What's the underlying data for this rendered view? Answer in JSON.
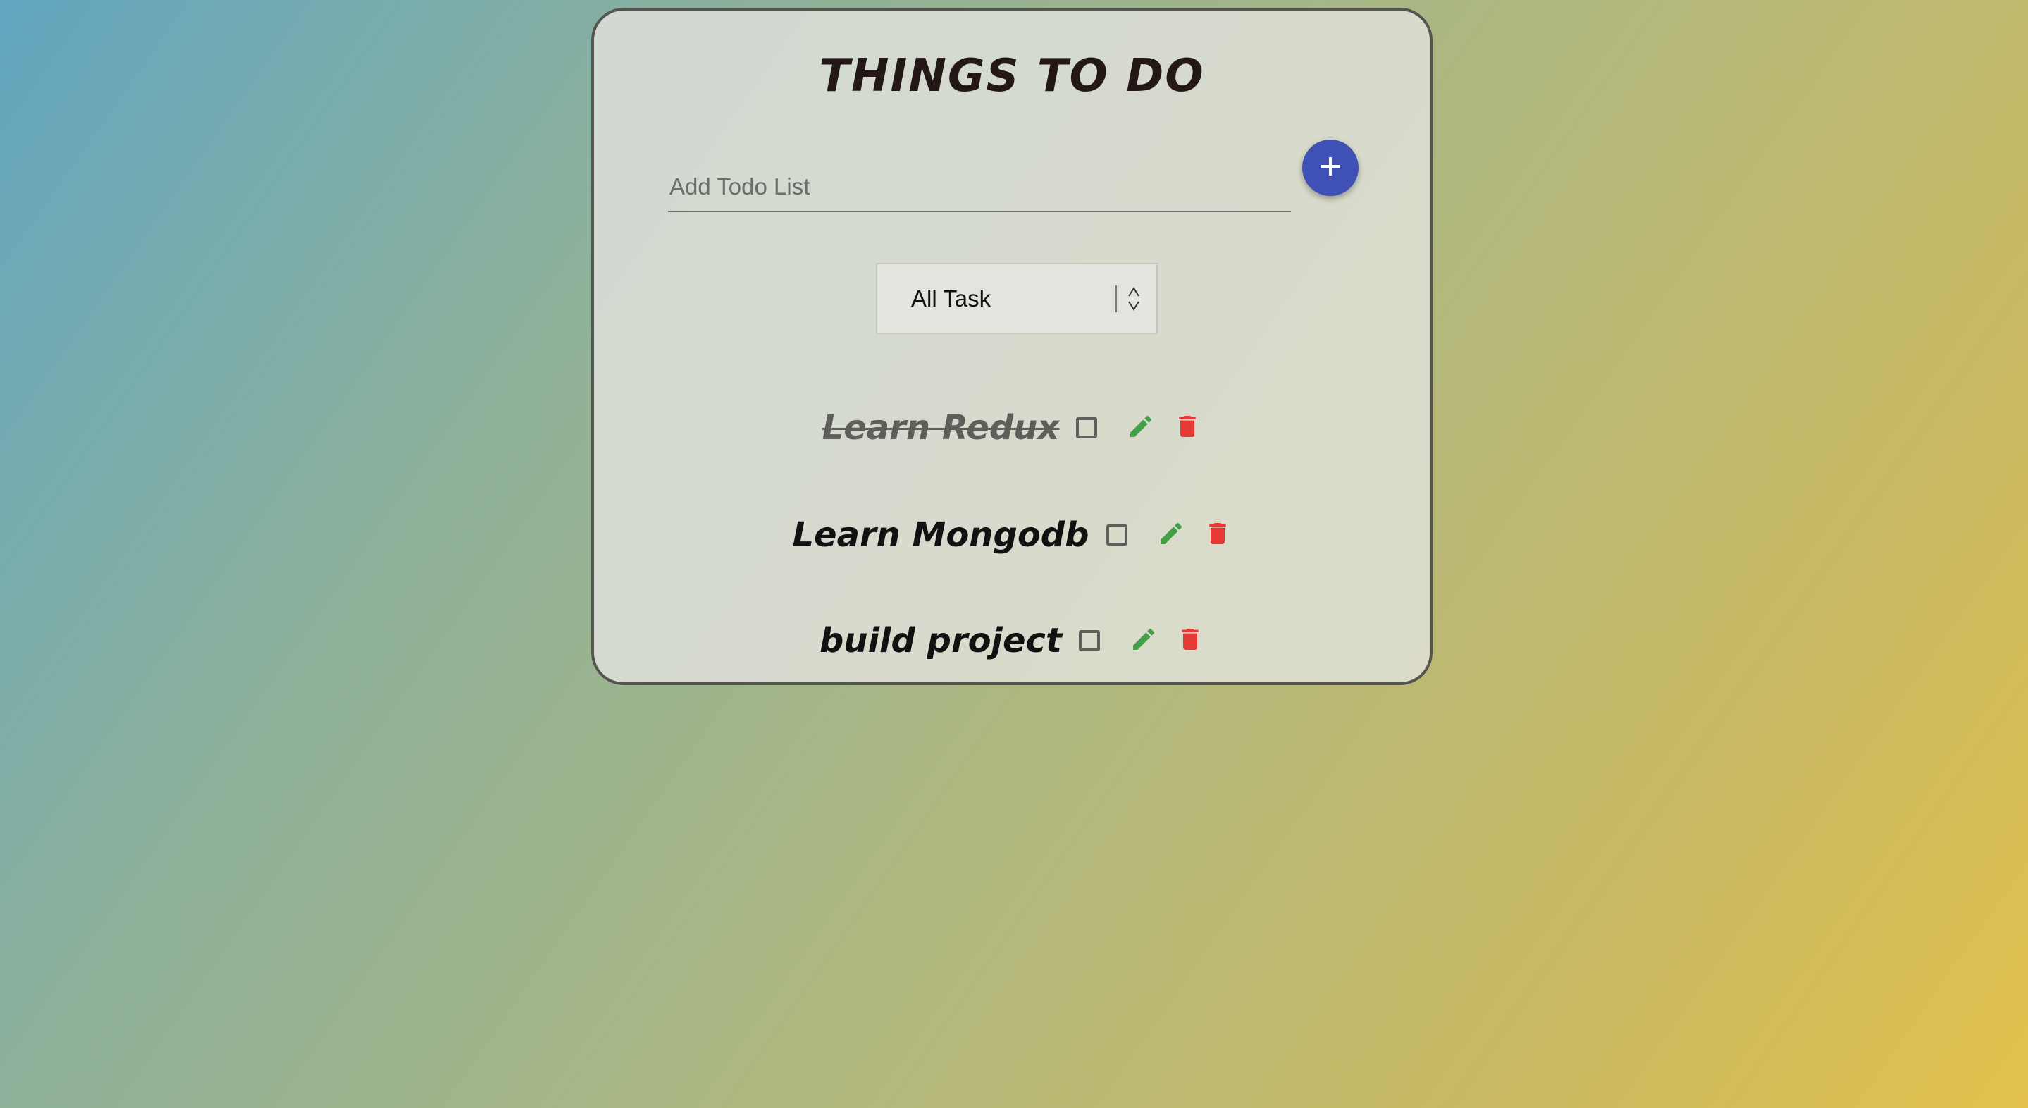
{
  "app": {
    "title": "THINGS TO DO"
  },
  "input": {
    "placeholder": "Add Todo List",
    "value": ""
  },
  "add_button": {
    "icon": "plus-icon",
    "color": "#3f51b5"
  },
  "filter": {
    "selected": "All Task"
  },
  "todos": [
    {
      "text": "Learn Redux",
      "completed": true
    },
    {
      "text": "Learn Mongodb",
      "completed": false
    },
    {
      "text": "build project",
      "completed": false
    }
  ],
  "colors": {
    "edit_icon": "#43a047",
    "delete_icon": "#e53935"
  }
}
